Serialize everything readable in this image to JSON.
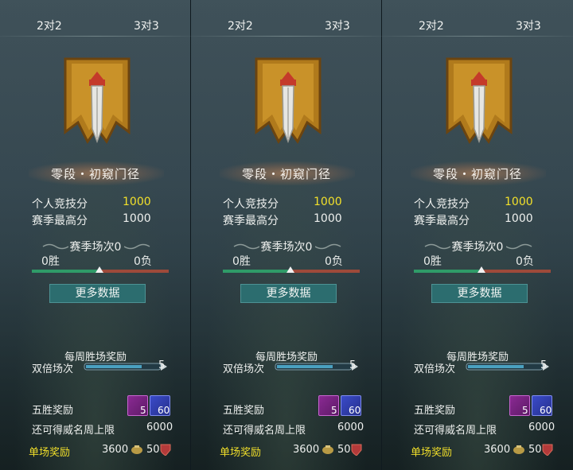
{
  "panels": [
    {
      "tabs": {
        "left": "2对2",
        "right": "3对3"
      },
      "rank_title": "零段・初窥门径",
      "stats": [
        {
          "label": "个人竞技分",
          "value": "1000"
        },
        {
          "label": "赛季最高分",
          "value": "1000"
        }
      ],
      "season": {
        "title": "赛季场次0",
        "wins": "0胜",
        "losses": "0负"
      },
      "more_button": "更多数据",
      "weekly": {
        "title": "每周胜场奖励",
        "double_label": "双倍场次",
        "double_count": "5"
      },
      "five_win": {
        "label": "五胜奖励",
        "chest_count": "5",
        "token_count": "60"
      },
      "limit": {
        "label": "还可得威名周上限",
        "value": "6000"
      },
      "single": {
        "label": "单场奖励",
        "coins": "3600",
        "honor": "50"
      }
    },
    {
      "tabs": {
        "left": "2对2",
        "right": "3对3"
      },
      "rank_title": "零段・初窥门径",
      "stats": [
        {
          "label": "个人竞技分",
          "value": "1000"
        },
        {
          "label": "赛季最高分",
          "value": "1000"
        }
      ],
      "season": {
        "title": "赛季场次0",
        "wins": "0胜",
        "losses": "0负"
      },
      "more_button": "更多数据",
      "weekly": {
        "title": "每周胜场奖励",
        "double_label": "双倍场次",
        "double_count": "5"
      },
      "five_win": {
        "label": "五胜奖励",
        "chest_count": "5",
        "token_count": "60"
      },
      "limit": {
        "label": "还可得威名周上限",
        "value": "6000"
      },
      "single": {
        "label": "单场奖励",
        "coins": "3600",
        "honor": "50"
      }
    },
    {
      "tabs": {
        "left": "2对2",
        "right": "3对3"
      },
      "rank_title": "零段・初窥门径",
      "stats": [
        {
          "label": "个人竞技分",
          "value": "1000"
        },
        {
          "label": "赛季最高分",
          "value": "1000"
        }
      ],
      "season": {
        "title": "赛季场次0",
        "wins": "0胜",
        "losses": "0负"
      },
      "more_button": "更多数据",
      "weekly": {
        "title": "每周胜场奖励",
        "double_label": "双倍场次",
        "double_count": "5"
      },
      "five_win": {
        "label": "五胜奖励",
        "chest_count": "5",
        "token_count": "60"
      },
      "limit": {
        "label": "还可得威名周上限",
        "value": "6000"
      },
      "single": {
        "label": "单场奖励",
        "coins": "3600",
        "honor": "50"
      }
    }
  ],
  "icons": {
    "emblem": "sword-banner-emblem-icon",
    "chest": "treasure-chest-icon",
    "token": "feather-token-icon",
    "coin": "coin-pouch-icon",
    "honor": "honor-shield-icon"
  },
  "colors": {
    "highlight_value": "#f2e02a",
    "single_reward_label": "#f0de2a",
    "button_bg": "#2c6d6f",
    "win_bar": "#2f9b68",
    "loss_bar": "#9e4a3a"
  }
}
